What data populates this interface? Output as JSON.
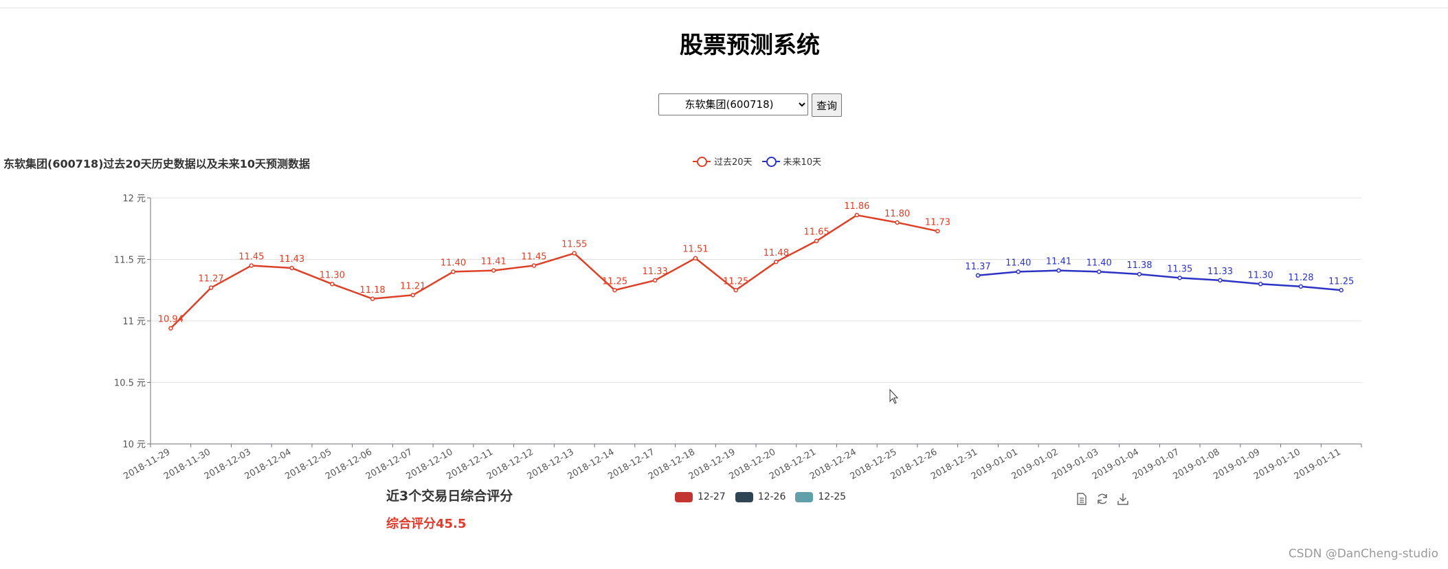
{
  "page": {
    "title": "股票预测系统"
  },
  "query": {
    "selected_stock": "东软集团(600718)",
    "button_label": "查询"
  },
  "chart_data": {
    "type": "line",
    "title": "东软集团(600718)过去20天历史数据以及未来10天预测数据",
    "x": [
      "2018-11-29",
      "2018-11-30",
      "2018-12-03",
      "2018-12-04",
      "2018-12-05",
      "2018-12-06",
      "2018-12-07",
      "2018-12-10",
      "2018-12-11",
      "2018-12-12",
      "2018-12-13",
      "2018-12-14",
      "2018-12-17",
      "2018-12-18",
      "2018-12-19",
      "2018-12-20",
      "2018-12-21",
      "2018-12-24",
      "2018-12-25",
      "2018-12-26",
      "2018-12-31",
      "2019-01-01",
      "2019-01-02",
      "2019-01-03",
      "2019-01-04",
      "2019-01-07",
      "2019-01-08",
      "2019-01-09",
      "2019-01-10",
      "2019-01-11"
    ],
    "series": [
      {
        "name": "过去20天",
        "color": "#dd4027",
        "values": [
          10.94,
          11.27,
          11.45,
          11.43,
          11.3,
          11.18,
          11.21,
          11.4,
          11.41,
          11.45,
          11.55,
          11.25,
          11.33,
          11.51,
          11.25,
          11.48,
          11.65,
          11.86,
          11.8,
          11.73,
          null,
          null,
          null,
          null,
          null,
          null,
          null,
          null,
          null,
          null
        ]
      },
      {
        "name": "未来10天",
        "color": "#2c33c4",
        "values": [
          null,
          null,
          null,
          null,
          null,
          null,
          null,
          null,
          null,
          null,
          null,
          null,
          null,
          null,
          null,
          null,
          null,
          null,
          null,
          null,
          11.37,
          11.4,
          11.41,
          11.4,
          11.38,
          11.35,
          11.33,
          11.3,
          11.28,
          11.25
        ]
      }
    ],
    "ylim": [
      10,
      12
    ],
    "yticks": [
      10,
      10.5,
      11,
      11.5,
      12
    ],
    "yunit": "元",
    "grid": true,
    "legend_position": "top-center"
  },
  "score": {
    "heading": "近3个交易日综合评分",
    "value_text": "综合评分45.5",
    "legend": [
      {
        "label": "12-27",
        "color": "#c23531"
      },
      {
        "label": "12-26",
        "color": "#2f4554"
      },
      {
        "label": "12-25",
        "color": "#61a0a8"
      }
    ]
  },
  "toolbox": {
    "icons": [
      "data-view-icon",
      "restore-icon",
      "save-image-icon"
    ]
  },
  "watermark": "CSDN @DanCheng-studio"
}
